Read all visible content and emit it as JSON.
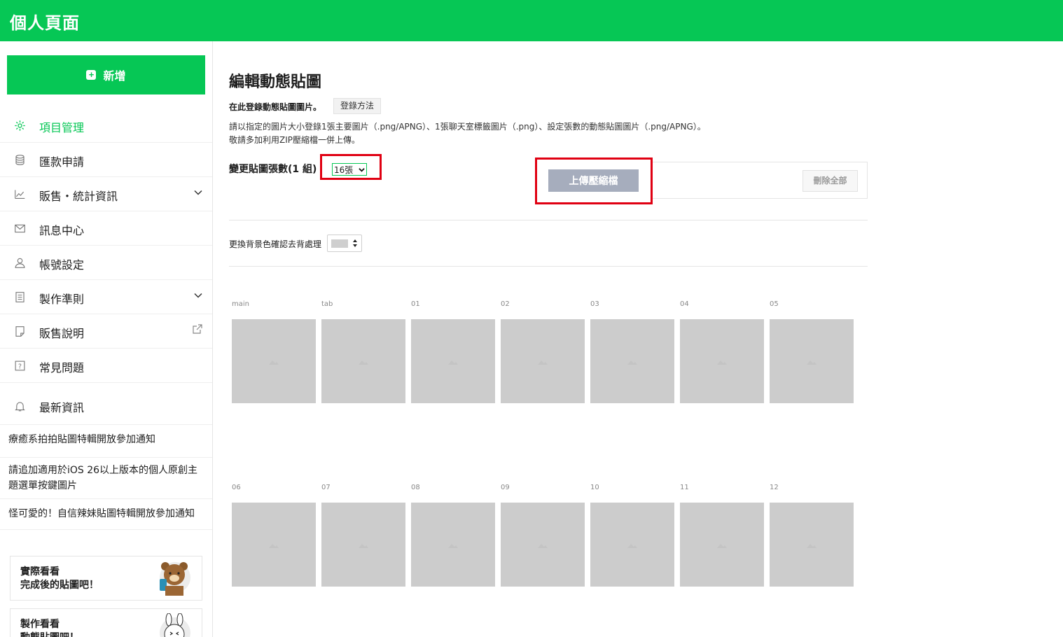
{
  "header": {
    "title": "個人頁面"
  },
  "sidebar": {
    "add_label": "新增",
    "items": [
      {
        "label": "項目管理",
        "icon": "gear-icon",
        "active": true
      },
      {
        "label": "匯款申請",
        "icon": "database-icon"
      },
      {
        "label": "販售・統計資訊",
        "icon": "chart-icon",
        "expandable": true
      },
      {
        "label": "訊息中心",
        "icon": "mail-icon"
      },
      {
        "label": "帳號設定",
        "icon": "person-icon"
      },
      {
        "label": "製作準則",
        "icon": "document-icon",
        "expandable": true
      },
      {
        "label": "販售說明",
        "icon": "page-icon",
        "external": true
      },
      {
        "label": "常見問題",
        "icon": "question-icon"
      }
    ],
    "news": {
      "label": "最新資訊",
      "icon": "bell-icon",
      "items": [
        "療癒系拍拍貼圖特輯開放參加通知",
        "請追加適用於iOS 26以上版本的個人原創主題選單按鍵圖片",
        "怪可愛的！自信辣妹貼圖特輯開放參加通知"
      ]
    },
    "promos": [
      {
        "line1": "實際看看",
        "line2": "完成後的貼圖吧！"
      },
      {
        "line1": "製作看看",
        "line2": "動態貼圖吧！"
      }
    ]
  },
  "main": {
    "title": "編輯動態貼圖",
    "lead": "在此登錄動態貼圖圖片。",
    "howto_label": "登錄方法",
    "desc_line1": "請以指定的圖片大小登錄1張主要圖片（.png/APNG）、1張聊天室標籤圖片（.png）、設定張數的動態貼圖圖片（.png/APNG）。",
    "desc_line2": "敬請多加利用ZIP壓縮檔一併上傳。",
    "count_label": "變更貼圖張數(1 組)",
    "count_value": "16張",
    "upload_label": "上傳壓縮檔",
    "delete_all_label": "刪除全部",
    "bg_label": "更換背景色確認去背處理",
    "bg_color": "#cfcfcf",
    "slots_row1": [
      "main",
      "tab",
      "01",
      "02",
      "03",
      "04",
      "05"
    ],
    "slots_row2": [
      "06",
      "07",
      "08",
      "09",
      "10",
      "11",
      "12"
    ]
  },
  "colors": {
    "brand": "#06c755",
    "highlight": "#e00012",
    "slot": "#cccccc"
  }
}
